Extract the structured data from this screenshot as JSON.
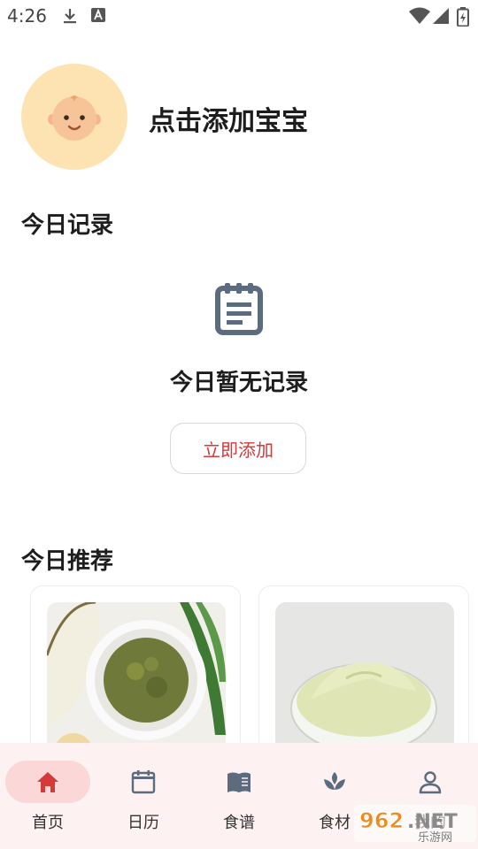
{
  "status_bar": {
    "time": "4:26"
  },
  "header": {
    "add_baby_label": "点击添加宝宝"
  },
  "today_record": {
    "title": "今日记录",
    "empty_text": "今日暂无记录",
    "add_button_label": "立即添加"
  },
  "recommend": {
    "title": "今日推荐",
    "cards": [
      {
        "image": "green-bean-puree-image"
      },
      {
        "image": "potato-puree-image"
      }
    ]
  },
  "nav": {
    "items": [
      {
        "label": "首页",
        "icon": "home-icon",
        "active": true
      },
      {
        "label": "日历",
        "icon": "calendar-icon",
        "active": false
      },
      {
        "label": "食谱",
        "icon": "book-icon",
        "active": false
      },
      {
        "label": "食材",
        "icon": "sprout-icon",
        "active": false
      },
      {
        "label": "我的",
        "icon": "person-icon",
        "active": false
      }
    ]
  },
  "watermark": {
    "text": "962.NET",
    "subtext": "乐游网"
  },
  "colors": {
    "accent": "#d43a3a",
    "nav_bg": "#fdf1f1",
    "nav_active": "#fbd7d7",
    "avatar_bg": "#fde3b2",
    "icon_gray": "#5c6b7e"
  }
}
